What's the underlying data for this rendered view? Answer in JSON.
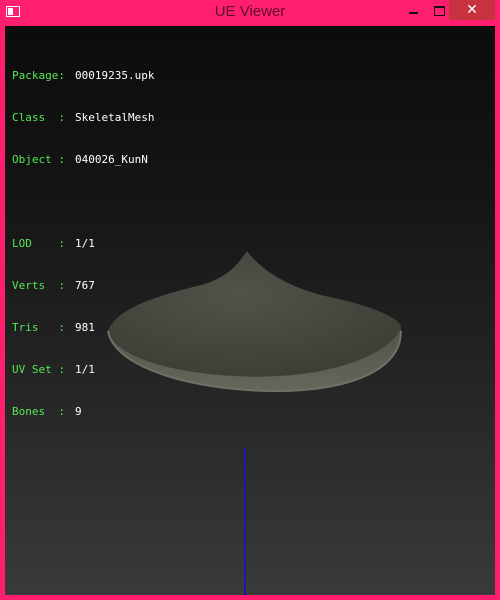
{
  "window": {
    "title": "UE Viewer"
  },
  "titlebar": {
    "minimize_icon": "minimize-icon",
    "maximize_icon": "maximize-icon",
    "close_icon": "close-icon",
    "close_glyph": "✕",
    "app_icon": "app-window-icon"
  },
  "info": {
    "package": {
      "label": "Package:",
      "value": "00019235.upk"
    },
    "class": {
      "label": "Class  :",
      "value": "SkeletalMesh"
    },
    "object": {
      "label": "Object :",
      "value": "040026_KunN"
    },
    "lod": {
      "label": "LOD    :",
      "value": "1/1"
    },
    "verts": {
      "label": "Verts  :",
      "value": "767"
    },
    "tris": {
      "label": "Tris   :",
      "value": "981"
    },
    "uvset": {
      "label": "UV Set :",
      "value": "1/1"
    },
    "bones": {
      "label": "Bones  :",
      "value": "9"
    }
  },
  "colors": {
    "label": "#55e755",
    "value": "#ffffff",
    "frame": "#ff1f6e",
    "close": "#c7323f",
    "axis": "#1a1aa8"
  }
}
